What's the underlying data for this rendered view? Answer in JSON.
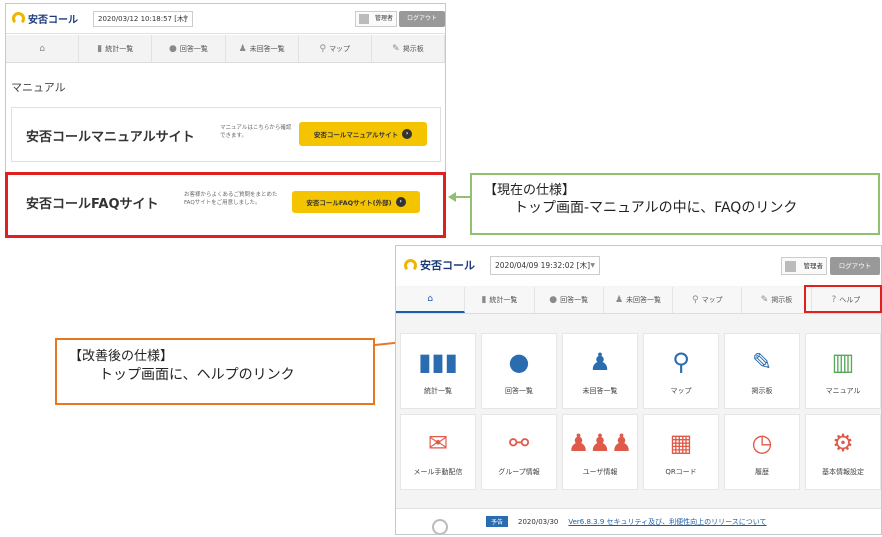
{
  "old_screen": {
    "logo": "安否コール",
    "datetime": "2020/03/12 10:18:57 [木]",
    "user": "管理者",
    "logout": "ログアウト",
    "nav": [
      {
        "label": "",
        "icon": "home-icon"
      },
      {
        "label": "統計一覧",
        "icon": "bar-chart-icon"
      },
      {
        "label": "回答一覧",
        "icon": "chat-icon"
      },
      {
        "label": "未回答一覧",
        "icon": "user-x-icon"
      },
      {
        "label": "マップ",
        "icon": "map-pin-icon"
      },
      {
        "label": "掲示板",
        "icon": "pencil-icon"
      }
    ],
    "manual_heading": "マニュアル",
    "manual_card": {
      "title": "安否コールマニュアルサイト",
      "desc": "マニュアルはこちらから確認できます。",
      "button": "安否コールマニュアルサイト"
    },
    "faq_card": {
      "title": "安否コールFAQサイト",
      "desc": "お客様からよくあるご質問をまとめたFAQサイトをご用意しました。",
      "button": "安否コールFAQサイト(外部)"
    }
  },
  "note_current": {
    "heading": "【現在の仕様】",
    "body": "トップ画面-マニュアルの中に、FAQのリンク"
  },
  "note_improved": {
    "heading": "【改善後の仕様】",
    "body": "トップ画面に、ヘルプのリンク"
  },
  "new_screen": {
    "logo": "安否コール",
    "datetime": "2020/04/09 19:32:02 [木]",
    "user": "管理者",
    "logout": "ログアウト",
    "nav": [
      {
        "label": "",
        "icon": "home-icon"
      },
      {
        "label": "統計一覧",
        "icon": "bar-chart-icon"
      },
      {
        "label": "回答一覧",
        "icon": "chat-icon"
      },
      {
        "label": "未回答一覧",
        "icon": "user-x-icon"
      },
      {
        "label": "マップ",
        "icon": "map-pin-icon"
      },
      {
        "label": "掲示板",
        "icon": "pencil-icon"
      },
      {
        "label": "ヘルプ",
        "icon": "question-icon"
      }
    ],
    "tiles": [
      {
        "label": "統計一覧",
        "icon": "bar-chart-icon",
        "color": "#2b6cb0"
      },
      {
        "label": "回答一覧",
        "icon": "chat-icon",
        "color": "#2b6cb0"
      },
      {
        "label": "未回答一覧",
        "icon": "user-x-icon",
        "color": "#2b6cb0"
      },
      {
        "label": "マップ",
        "icon": "map-pin-icon",
        "color": "#2b6cb0"
      },
      {
        "label": "掲示板",
        "icon": "pencil-icon",
        "color": "#2b6cb0"
      },
      {
        "label": "マニュアル",
        "icon": "book-icon",
        "color": "#5aa85a"
      },
      {
        "label": "メール手動配信",
        "icon": "mail-icon",
        "color": "#e05a4a"
      },
      {
        "label": "グループ情報",
        "icon": "org-chart-icon",
        "color": "#e05a4a"
      },
      {
        "label": "ユーザ情報",
        "icon": "users-icon",
        "color": "#e05a4a"
      },
      {
        "label": "QRコード",
        "icon": "qr-code-icon",
        "color": "#e05a4a"
      },
      {
        "label": "履歴",
        "icon": "clock-icon",
        "color": "#e05a4a"
      },
      {
        "label": "基本情報設定",
        "icon": "gear-icon",
        "color": "#e05a4a"
      }
    ],
    "news": {
      "badge": "予告",
      "date": "2020/03/30",
      "link": "Ver6.8.3.9 セキュリティ及び、利便性向上のリリースについて"
    }
  },
  "colors": {
    "highlight_red": "#e01f1f",
    "note_green": "#90c070",
    "note_orange": "#e87722",
    "brand_blue": "#2b6cb0",
    "button_yellow": "#f5c400"
  }
}
